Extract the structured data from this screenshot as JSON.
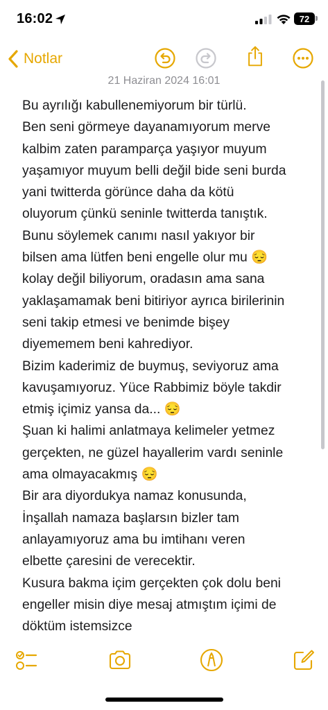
{
  "status_bar": {
    "time": "16:02",
    "battery": "72"
  },
  "nav": {
    "back_label": "Notlar"
  },
  "note": {
    "date": "21 Haziran 2024 16:01",
    "lines": [
      "Bu ayrılığı kabullenemiyorum bir türlü.",
      "Ben seni görmeye dayanamıyorum merve",
      "kalbim zaten paramparça yaşıyor muyum",
      "yaşamıyor muyum belli değil bide seni burda",
      "yani twitterda görünce daha da kötü",
      "oluyorum çünkü seninle twitterda tanıştık.",
      "Bunu söylemek canımı nasıl yakıyor bir",
      "bilsen ama lütfen beni engelle olur mu 😔",
      "kolay değil biliyorum, oradasın ama sana",
      "yaklaşamamak beni bitiriyor ayrıca birilerinin",
      "seni takip etmesi ve benimde bişey",
      "diyememem beni kahrediyor.",
      "Bizim kaderimiz de buymuş, seviyoruz ama",
      "kavuşamıyoruz. Yüce Rabbimiz böyle takdir",
      "etmiş içimiz yansa da... 😔",
      "Şuan ki halimi anlatmaya kelimeler yetmez",
      "gerçekten, ne güzel hayallerim vardı seninle",
      "ama olmayacakmış 😔",
      "Bir ara diyordukya namaz konusunda,",
      "İnşallah namaza başlarsın bizler tam",
      "anlayamıyoruz ama bu imtihanı veren",
      "elbette çaresini de verecektir.",
      "Kusura bakma içim gerçekten çok dolu beni",
      "engeller misin diye mesaj atmıştım içimi de",
      "döktüm istemsizce"
    ]
  },
  "icons": {
    "location": "location-arrow-icon",
    "signal": "cellular-signal-icon",
    "wifi": "wifi-icon",
    "back": "chevron-left-icon",
    "undo": "undo-icon",
    "redo": "redo-icon",
    "share": "share-icon",
    "more": "more-icon",
    "checklist": "checklist-icon",
    "camera": "camera-icon",
    "markup": "markup-pen-icon",
    "compose": "compose-icon"
  },
  "colors": {
    "accent": "#e6a700",
    "disabled": "#c7c7cc",
    "secondary_text": "#8e8e93",
    "body_text": "#1c1c1e"
  }
}
